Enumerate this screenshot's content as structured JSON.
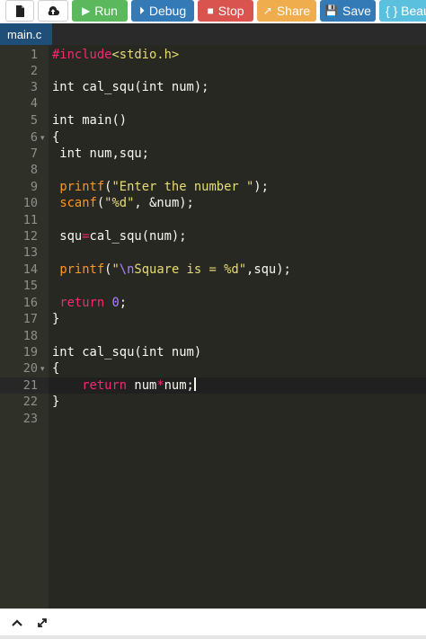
{
  "toolbar": {
    "run_label": "Run",
    "debug_label": "Debug",
    "stop_label": "Stop",
    "share_label": "Share",
    "save_label": "Save",
    "beautify_label": "{ } Beau"
  },
  "tab": {
    "filename": "main.c"
  },
  "editor": {
    "line_numbers": [
      "1",
      "2",
      "3",
      "4",
      "5",
      "6",
      "7",
      "8",
      "9",
      "10",
      "11",
      "12",
      "13",
      "14",
      "15",
      "16",
      "17",
      "18",
      "19",
      "20",
      "21",
      "22",
      "23"
    ],
    "active_line": 21,
    "lines": [
      "#include<stdio.h>",
      "",
      "int cal_squ(int num);",
      "",
      "int main()",
      "{",
      " int num,squ;",
      "",
      " printf(\"Enter the number \");",
      " scanf(\"%d\", &num);",
      "",
      " squ=cal_squ(num);",
      "",
      " printf(\"\\nSquare is = %d\",squ);",
      "",
      " return 0;",
      "}",
      "",
      "int cal_squ(int num)",
      "{",
      "    return num*num;",
      "}",
      ""
    ]
  },
  "icons": {
    "new": "file-icon",
    "upload": "upload-icon",
    "run": "play-icon",
    "debug": "debug-icon",
    "stop": "stop-icon",
    "share": "share-icon",
    "save": "save-icon",
    "collapse": "chevron-up-icon",
    "expand": "expand-icon"
  },
  "colors": {
    "run": "#5cb85c",
    "debug": "#337ab7",
    "stop": "#d9534f",
    "share": "#f0ad4e",
    "save": "#337ab7",
    "beautify": "#5bc0de",
    "editor_bg": "#272822",
    "tab_bg": "#1f4e79"
  }
}
